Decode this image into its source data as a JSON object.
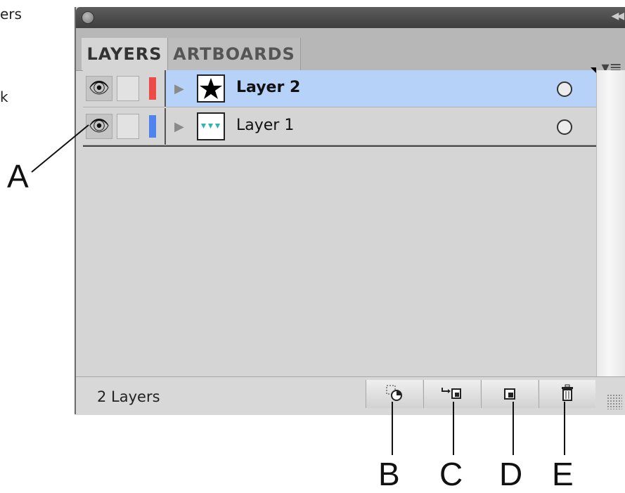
{
  "stray_text": {
    "top": "ers",
    "mid": "k"
  },
  "panel": {
    "tabs": [
      {
        "label": "LAYERS",
        "active": true
      },
      {
        "label": "ARTBOARDS",
        "active": false
      }
    ],
    "menu_icon": "panel-menu-icon",
    "collapse_icon": "double-left-arrow-icon",
    "layers": [
      {
        "name": "Layer 2",
        "selected": true,
        "color": "#ee4a4a",
        "thumbnail": "star-icon",
        "visible": true
      },
      {
        "name": "Layer 1",
        "selected": false,
        "color": "#4f83ee",
        "thumbnail": "teal-shapes-icon",
        "visible": true
      }
    ],
    "footer": {
      "count": "2 Layers",
      "buttons": [
        {
          "name": "make-clipping-mask-button",
          "icon": "clipping-mask-icon"
        },
        {
          "name": "create-sublayer-button",
          "icon": "new-sublayer-icon"
        },
        {
          "name": "create-new-layer-button",
          "icon": "new-layer-icon"
        },
        {
          "name": "delete-layer-button",
          "icon": "trash-icon"
        }
      ]
    }
  },
  "callouts": {
    "a": "A",
    "b": "B",
    "c": "C",
    "d": "D",
    "e": "E"
  },
  "colors": {
    "selection": "#b7d2f8",
    "panel_bg": "#d5d5d5",
    "titlebar": "#4a4a4a"
  }
}
